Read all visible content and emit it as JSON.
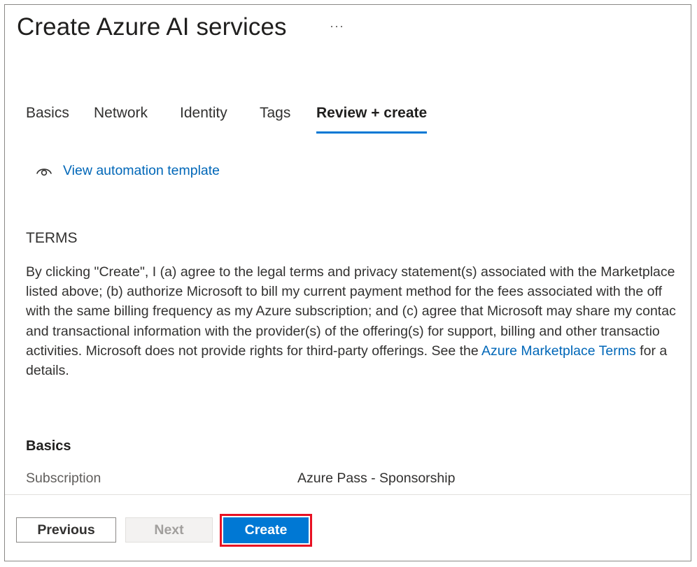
{
  "header": {
    "title": "Create Azure AI services",
    "more_label": "···"
  },
  "tabs": [
    {
      "label": "Basics",
      "active": false
    },
    {
      "label": "Network",
      "active": false
    },
    {
      "label": "Identity",
      "active": false
    },
    {
      "label": "Tags",
      "active": false
    },
    {
      "label": "Review + create",
      "active": true
    }
  ],
  "automation": {
    "icon": "eye-icon",
    "link_label": "View automation template"
  },
  "terms": {
    "heading": "TERMS",
    "lines": [
      "By clicking \"Create\", I (a) agree to the legal terms and privacy statement(s) associated with the Marketplace",
      "listed above; (b) authorize Microsoft to bill my current payment method for the fees associated with the off",
      "with the same billing frequency as my Azure subscription; and (c) agree that Microsoft may share my contac",
      "and transactional information with the provider(s) of the offering(s) for support, billing and other transactio"
    ],
    "line5_prefix": "activities. Microsoft does not provide rights for third-party offerings. See the ",
    "line5_link": "Azure Marketplace Terms",
    "line5_suffix": " for a",
    "line6": "details."
  },
  "basics": {
    "heading": "Basics",
    "fields": [
      {
        "label": "Subscription",
        "value": "Azure Pass - Sponsorship"
      }
    ]
  },
  "footer": {
    "previous_label": "Previous",
    "next_label": "Next",
    "create_label": "Create"
  },
  "colors": {
    "accent": "#0078d4",
    "link": "#0067b8",
    "highlight_border": "#e81123"
  }
}
